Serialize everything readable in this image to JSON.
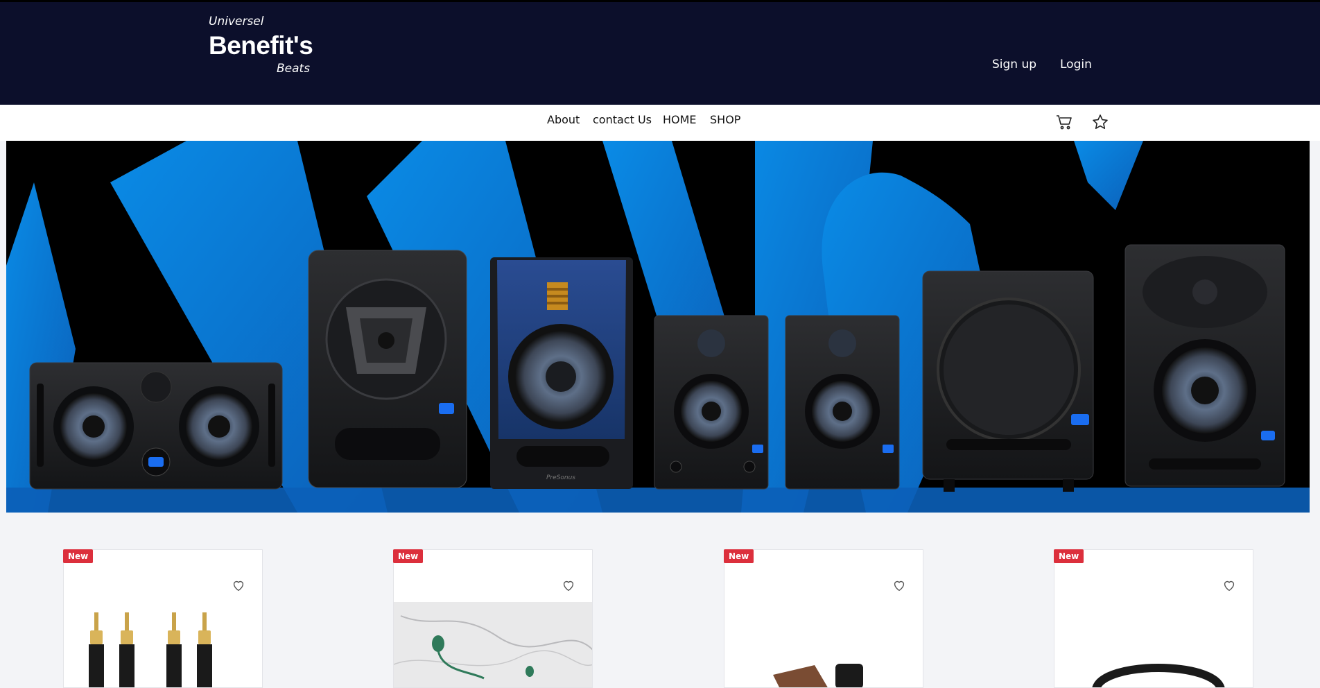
{
  "header": {
    "logo_top": "Universel",
    "logo_main": "Benefit's",
    "logo_sub": "Beats",
    "signup_label": "Sign up",
    "login_label": "Login"
  },
  "nav": {
    "items": [
      "About",
      "contact Us",
      "HOME",
      "SHOP"
    ],
    "cart_icon": "cart-icon",
    "wishlist_icon": "star-icon"
  },
  "hero": {
    "image": "studio-monitor-speakers-banner",
    "brand_text": "PreSonus"
  },
  "products": [
    {
      "badge": "New",
      "image": "rca-cable-connectors"
    },
    {
      "badge": "New",
      "image": "green-earbuds-on-marble"
    },
    {
      "badge": "New",
      "image": "leather-accessories"
    },
    {
      "badge": "New",
      "image": "black-headphones"
    }
  ],
  "colors": {
    "header_bg": "#0c0f2b",
    "badge": "#dc2f3c",
    "hero_blue": "#0a7bd6"
  }
}
